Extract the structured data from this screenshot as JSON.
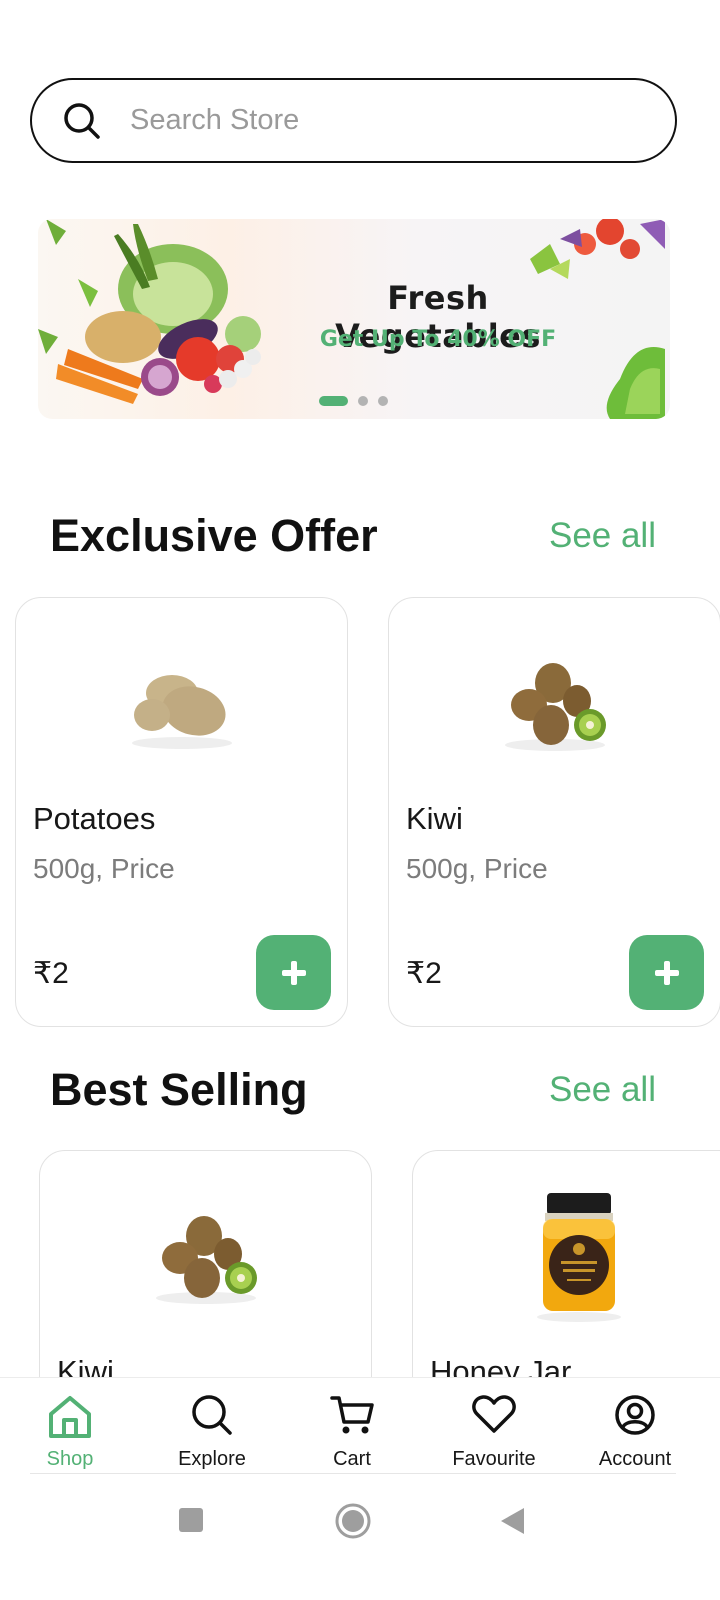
{
  "search": {
    "placeholder": "Search Store"
  },
  "banner": {
    "title": "Fresh Vegetables",
    "subtitle": "Get Up To 40% OFF",
    "slides": 3,
    "active_slide": 1
  },
  "exclusive_offer": {
    "title": "Exclusive Offer",
    "see_all": "See all",
    "products": [
      {
        "name": "Potatoes",
        "unit": "500g, Price",
        "price": "₹2"
      },
      {
        "name": "Kiwi",
        "unit": "500g, Price",
        "price": "₹2"
      }
    ]
  },
  "best_selling": {
    "title": "Best Selling",
    "see_all": "See all",
    "products": [
      {
        "name": "Kiwi"
      },
      {
        "name": "Honey Jar"
      }
    ]
  },
  "nav": {
    "items": [
      {
        "label": "Shop",
        "icon": "home-icon",
        "active": true
      },
      {
        "label": "Explore",
        "icon": "search-icon",
        "active": false
      },
      {
        "label": "Cart",
        "icon": "cart-icon",
        "active": false
      },
      {
        "label": "Favourite",
        "icon": "heart-icon",
        "active": false
      },
      {
        "label": "Account",
        "icon": "account-icon",
        "active": false
      }
    ]
  },
  "colors": {
    "accent": "#53b175",
    "text": "#181818",
    "muted": "#7c7c7c"
  }
}
